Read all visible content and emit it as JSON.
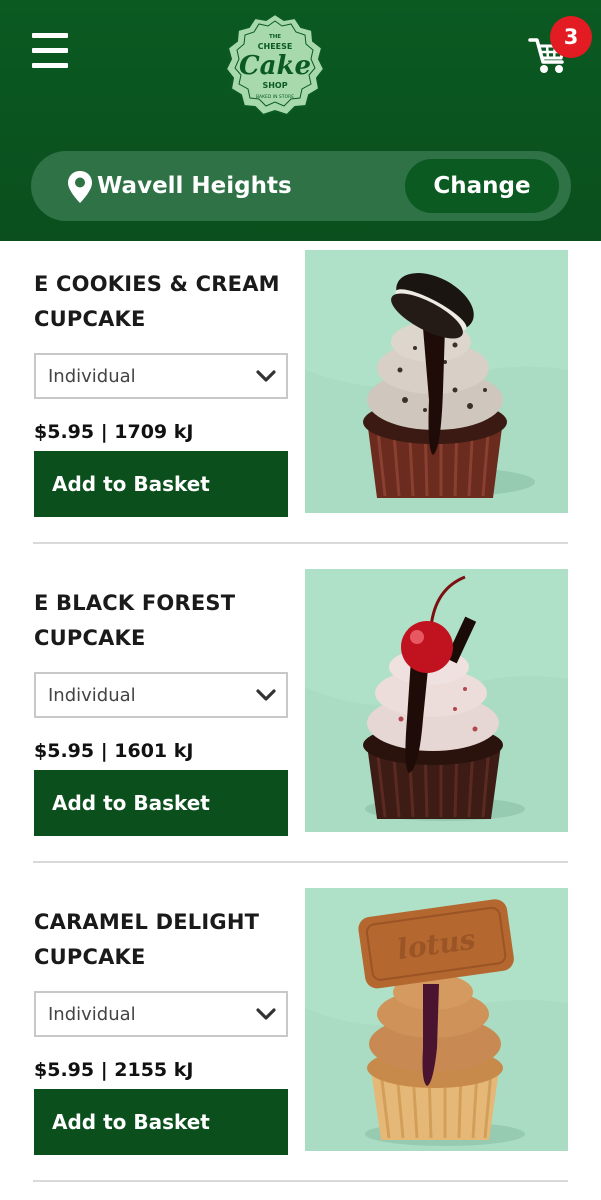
{
  "header": {
    "logo": {
      "line1": "THE",
      "line2": "CHEESE",
      "line3": "Cake",
      "line4": "SHOP",
      "line5": "BAKED IN STORE"
    },
    "cart_count": "3",
    "location": "Wavell Heights",
    "change_label": "Change"
  },
  "colors": {
    "header_green": "#0b5a22",
    "button_green": "#0b4f1d",
    "badge_red": "#e31b23",
    "image_bg_mint": "#a9dcc3"
  },
  "products": [
    {
      "title_line1": "E COOKIES & CREAM",
      "title_line2": "CUPCAKE",
      "size": "Individual",
      "price_energy": "$5.95 | 1709 kJ",
      "add_label": "Add to Basket"
    },
    {
      "title_line1": "E BLACK FOREST",
      "title_line2": "CUPCAKE",
      "size": "Individual",
      "price_energy": "$5.95 | 1601 kJ",
      "add_label": "Add to Basket"
    },
    {
      "title_line1": "CARAMEL DELIGHT",
      "title_line2": "CUPCAKE",
      "size": "Individual",
      "price_energy": "$5.95 | 2155 kJ",
      "add_label": "Add to Basket"
    }
  ]
}
